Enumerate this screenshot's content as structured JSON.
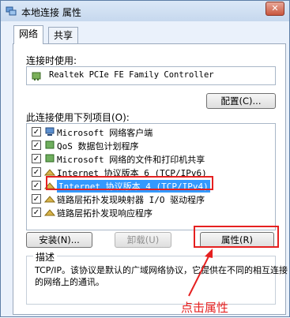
{
  "window": {
    "title": "本地连接 属性"
  },
  "tabs": [
    {
      "label": "网络",
      "active": true
    },
    {
      "label": "共享",
      "active": false
    }
  ],
  "connection": {
    "label": "连接时使用:",
    "adapter": "Realtek PCIe FE Family Controller",
    "configure_button": "配置(C)..."
  },
  "items": {
    "label": "此连接使用下列项目(O):",
    "list": [
      {
        "checked": true,
        "text": "Microsoft 网络客户端",
        "icon": "network-client-icon"
      },
      {
        "checked": true,
        "text": "QoS 数据包计划程序",
        "icon": "qos-icon"
      },
      {
        "checked": true,
        "text": "Microsoft 网络的文件和打印机共享",
        "icon": "file-printer-sharing-icon"
      },
      {
        "checked": true,
        "text": "Internet 协议版本 6 (TCP/IPv6)",
        "icon": "protocol-icon"
      },
      {
        "checked": true,
        "text": "Internet 协议版本 4 (TCP/IPv4)",
        "icon": "protocol-icon",
        "selected": true
      },
      {
        "checked": true,
        "text": "链路层拓扑发现映射器 I/O 驱动程序",
        "icon": "protocol-icon"
      },
      {
        "checked": true,
        "text": "链路层拓扑发现响应程序",
        "icon": "protocol-icon"
      }
    ]
  },
  "buttons": {
    "install": "安装(N)...",
    "uninstall": "卸载(U)",
    "properties": "属性(R)"
  },
  "description": {
    "legend": "描述",
    "text": "TCP/IP。该协议是默认的广域网络协议，它提供在不同的相互连接的网络上的通讯。"
  },
  "annotation": {
    "text": "点击属性",
    "color": "#e52020"
  },
  "colors": {
    "selection": "#3399ff",
    "highlight": "#e52020"
  }
}
